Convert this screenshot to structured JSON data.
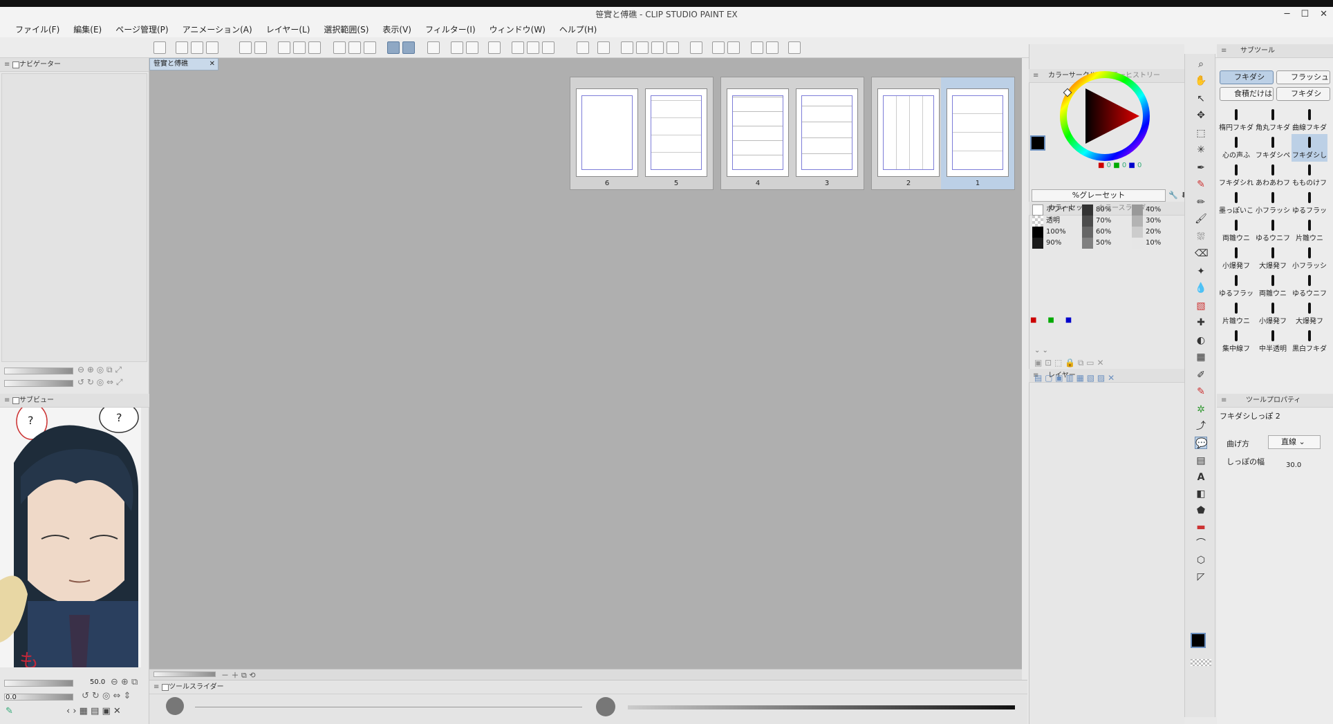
{
  "window": {
    "title": "笹實と傅礁 - CLIP STUDIO PAINT EX",
    "controls": [
      "─",
      "☐",
      "✕"
    ]
  },
  "menu": [
    "ファイル(F)",
    "編集(E)",
    "ページ管理(P)",
    "アニメーション(A)",
    "レイヤー(L)",
    "選択範囲(S)",
    "表示(V)",
    "フィルター(I)",
    "ウィンドウ(W)",
    "ヘルプ(H)"
  ],
  "panels": {
    "navigator": "ナビゲーター",
    "subview": "サブビュー",
    "subview_zoom": "50.0",
    "subview_angle": "0.0",
    "tool_slider": "ツールスライダー",
    "color_circle": "カラーサークル",
    "color_history": "カラーヒストリー",
    "color_set": "カラーセット",
    "color_slider": "カラースライダー",
    "color_set_name": "%グレーセット",
    "layer": "レイヤー",
    "subtool": "サブツール",
    "tool_property": "ツールプロパティ",
    "rgb": [
      "0",
      "0",
      "0"
    ]
  },
  "document": {
    "tab": "笹實と傅礁",
    "pages": [
      "6",
      "5",
      "4",
      "3",
      "2",
      "1"
    ]
  },
  "color_set": {
    "col1": [
      "ホワイト",
      "透明",
      "100%",
      "90%"
    ],
    "col2": [
      "80%",
      "70%",
      "60%",
      "50%"
    ],
    "col3": [
      "40%",
      "30%",
      "20%",
      "10%"
    ]
  },
  "subtool": {
    "groups": [
      "フキダシ",
      "フラッシュ",
      "食積だけは",
      "フキダシ"
    ],
    "brushes": [
      "楕円フキダ",
      "角丸フキダ",
      "曲線フキダ",
      "心の声ふ",
      "フキダシペ",
      "フキダシし",
      "フキダシれ",
      "あわあわフ",
      "もものけフ",
      "墨っぽいこ",
      "小フラッシ",
      "ゆるフラッ",
      "両雛ウニ",
      "ゆるウニフ",
      "片雛ウニ",
      "小爆発フ",
      "大爆発フ",
      "小フラッシ",
      "ゆるフラッ",
      "両雛ウニ",
      "ゆるウニフ",
      "片雛ウニ",
      "小爆発フ",
      "大爆発フ",
      "集中線フ",
      "中半透明",
      "黒白フキダ"
    ]
  },
  "tool_property": {
    "title": "フキダシしっぽ 2",
    "bend_label": "曲げ方",
    "bend_value": "直線",
    "width_label": "しっぽの幅",
    "width_value": "30.0"
  },
  "colors": {
    "accent": "#8fa8c4",
    "selection": "#bcd0e6",
    "canvas": "#afafaf"
  }
}
